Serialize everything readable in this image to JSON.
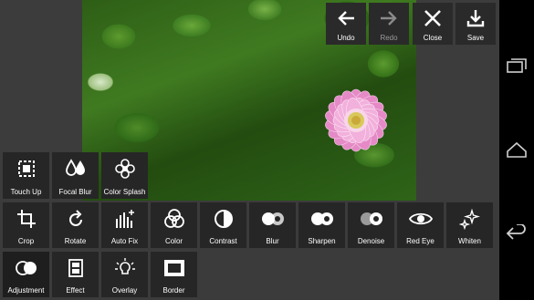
{
  "toolbar": {
    "undo_label": "Undo",
    "redo_label": "Redo",
    "close_label": "Close",
    "save_label": "Save"
  },
  "tools": {
    "row1": [
      "Touch Up",
      "Focal Blur",
      "Color Splash"
    ],
    "row2": [
      "Crop",
      "Rotate",
      "Auto Fix",
      "Color",
      "Contrast",
      "Blur",
      "Sharpen",
      "Denoise",
      "Red Eye",
      "Whiten"
    ],
    "row3": [
      "Adjustment",
      "Effect",
      "Overlay",
      "Border"
    ]
  },
  "colors": {
    "tile_bg": "#262626",
    "panel_bg": "#3c3c3c",
    "icon": "#ffffff",
    "disabled": "#9a9a9a"
  }
}
